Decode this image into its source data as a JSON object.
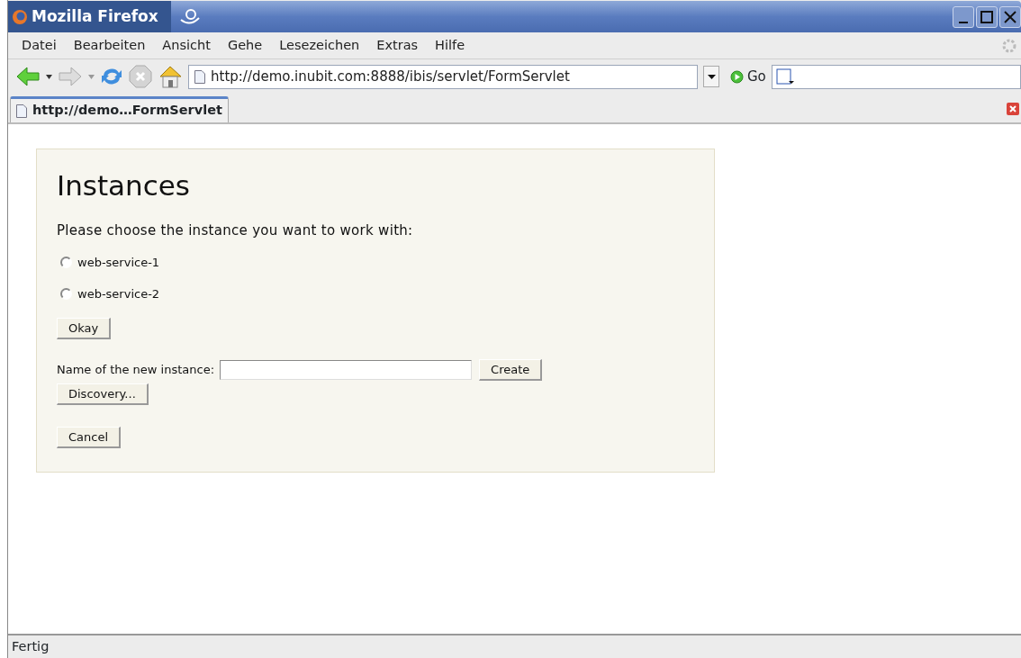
{
  "window": {
    "title": "Mozilla Firefox"
  },
  "menu": [
    {
      "label": "Datei"
    },
    {
      "label": "Bearbeiten"
    },
    {
      "label": "Ansicht"
    },
    {
      "label": "Gehe"
    },
    {
      "label": "Lesezeichen"
    },
    {
      "label": "Extras"
    },
    {
      "label": "Hilfe"
    }
  ],
  "toolbar": {
    "address": "http://demo.inubit.com:8888/ibis/servlet/FormServlet",
    "go_label": "Go"
  },
  "tabs": [
    {
      "label": "http://demo…FormServlet",
      "selected": true
    }
  ],
  "page": {
    "heading": "Instances",
    "prompt": "Please choose the instance you want to work with:",
    "instances": [
      {
        "label": "web-service-1",
        "selected": false
      },
      {
        "label": "web-service-2",
        "selected": false
      }
    ],
    "okay_button": "Okay",
    "new_label": "Name of the new instance:",
    "create_button": "Create",
    "discovery_button": "Discovery...",
    "cancel_button": "Cancel"
  },
  "status_bar": {
    "text": "Fertig"
  }
}
